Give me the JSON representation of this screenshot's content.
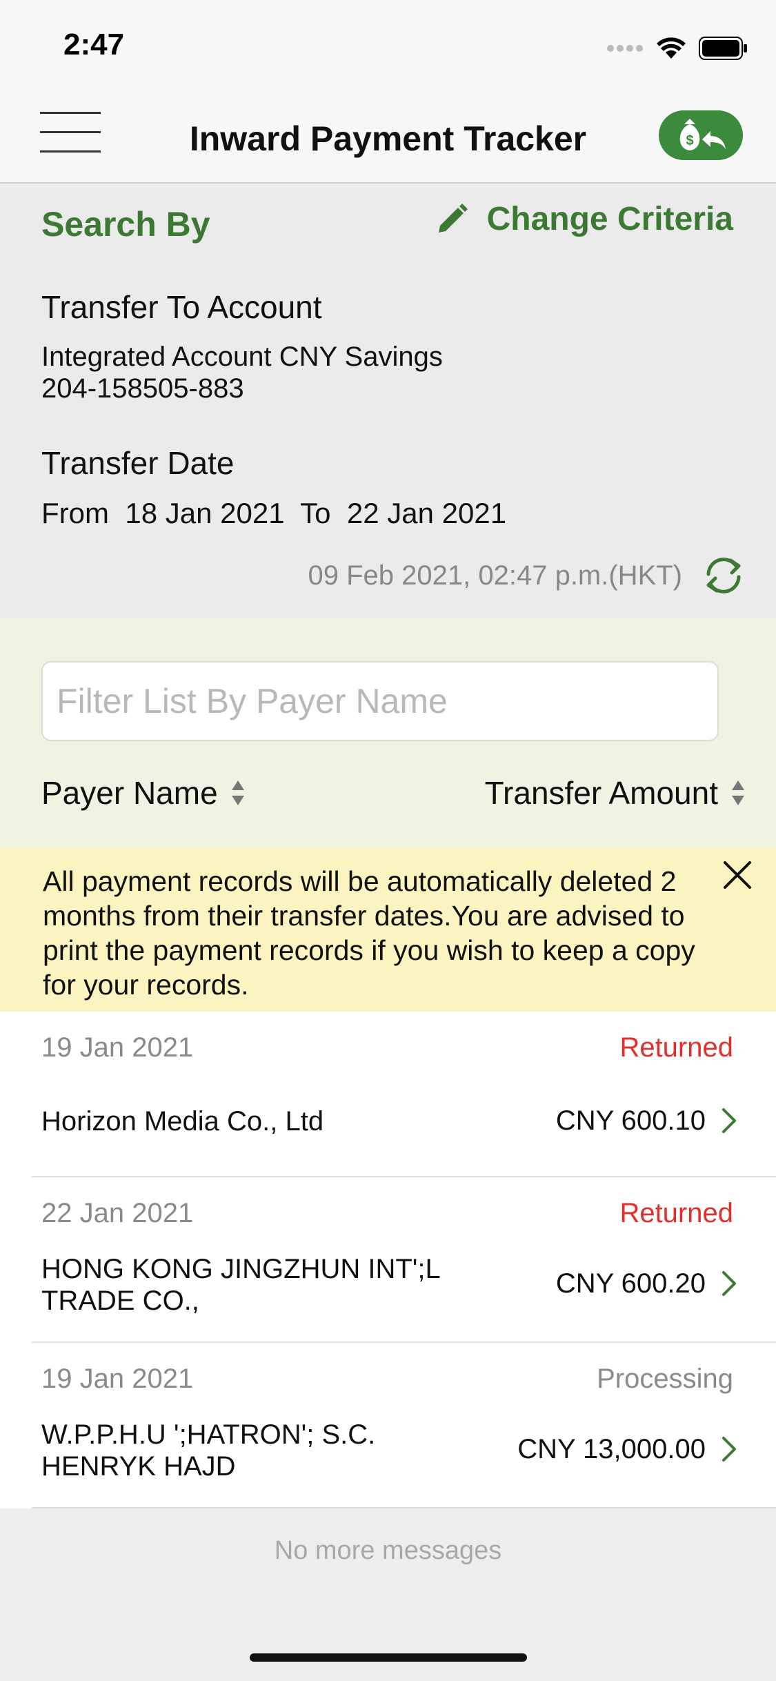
{
  "status_bar": {
    "time": "2:47"
  },
  "nav": {
    "title": "Inward Payment Tracker"
  },
  "criteria": {
    "search_by": "Search By",
    "change_criteria": "Change Criteria",
    "account_label": "Transfer To Account",
    "account_name": "Integrated Account CNY Savings",
    "account_number": "204-158505-883",
    "date_label": "Transfer Date",
    "from_label": "From",
    "from_date": "18 Jan 2021",
    "to_label": "To",
    "to_date": "22 Jan 2021",
    "last_updated": "09 Feb 2021, 02:47 p.m.(HKT)"
  },
  "filter": {
    "placeholder": "Filter List By Payer Name",
    "col_payer": "Payer Name",
    "col_amount": "Transfer Amount"
  },
  "notice": {
    "text": "All payment records will be automatically deleted 2 months from their transfer dates.You are advised to print the payment records if you wish to keep a copy for your records."
  },
  "records": [
    {
      "date": "19 Jan 2021",
      "status": "Returned",
      "payer": "Horizon Media Co., Ltd",
      "amount": "CNY 600.10"
    },
    {
      "date": "22 Jan 2021",
      "status": "Returned",
      "payer": "HONG KONG JINGZHUN INT';L TRADE CO.,",
      "amount": "CNY 600.20"
    },
    {
      "date": "19 Jan 2021",
      "status": "Processing",
      "payer": "W.P.P.H.U ';HATRON'; S.C. HENRYK HAJD",
      "amount": "CNY 13,000.00"
    }
  ],
  "footer": {
    "no_more": "No more messages"
  },
  "colors": {
    "brand_green": "#3c7a34",
    "returned_red": "#e0302a",
    "processing_gray": "#8a8a8a",
    "notice_yellow": "#fbf4c0",
    "filter_bg": "#eff3e1"
  }
}
